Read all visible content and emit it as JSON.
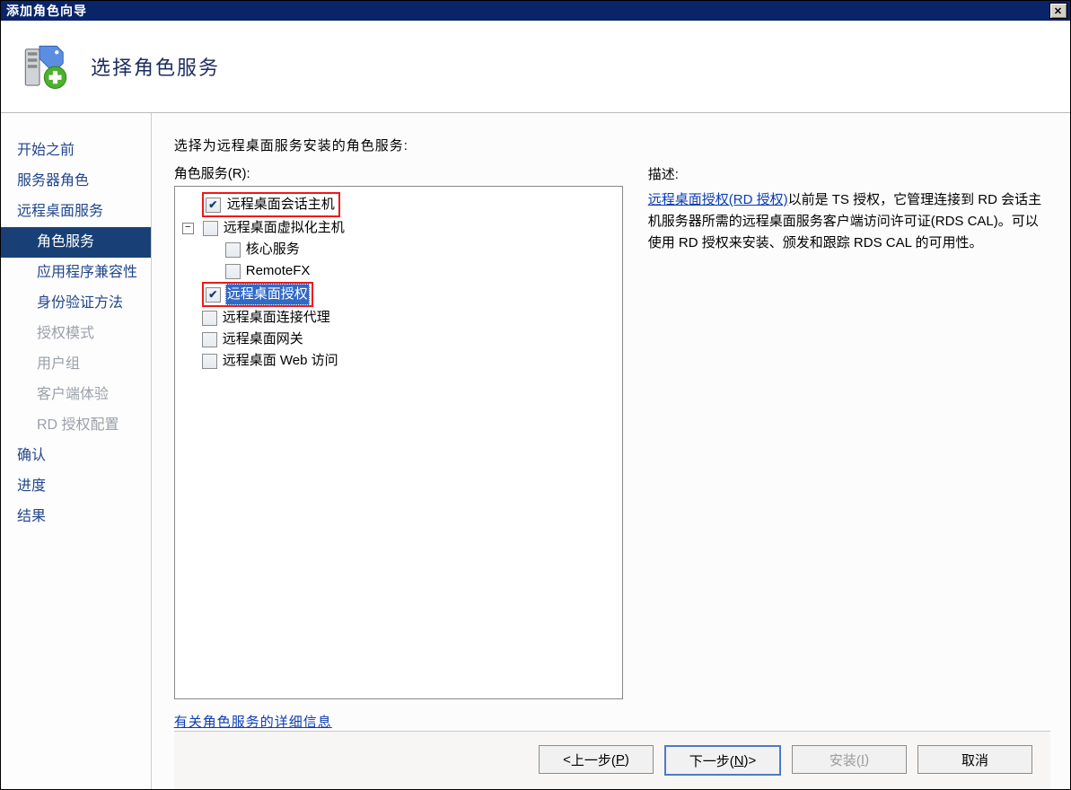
{
  "window": {
    "title": "添加角色向导"
  },
  "header": {
    "page_title": "选择角色服务"
  },
  "sidebar": {
    "items": [
      {
        "label": "开始之前",
        "level": 1,
        "selected": false,
        "disabled": false
      },
      {
        "label": "服务器角色",
        "level": 1,
        "selected": false,
        "disabled": false
      },
      {
        "label": "远程桌面服务",
        "level": 1,
        "selected": false,
        "disabled": false
      },
      {
        "label": "角色服务",
        "level": 2,
        "selected": true,
        "disabled": false
      },
      {
        "label": "应用程序兼容性",
        "level": 2,
        "selected": false,
        "disabled": false
      },
      {
        "label": "身份验证方法",
        "level": 2,
        "selected": false,
        "disabled": false
      },
      {
        "label": "授权模式",
        "level": 2,
        "selected": false,
        "disabled": true
      },
      {
        "label": "用户组",
        "level": 2,
        "selected": false,
        "disabled": true
      },
      {
        "label": "客户端体验",
        "level": 2,
        "selected": false,
        "disabled": true
      },
      {
        "label": "RD 授权配置",
        "level": 2,
        "selected": false,
        "disabled": true
      },
      {
        "label": "确认",
        "level": 1,
        "selected": false,
        "disabled": false
      },
      {
        "label": "进度",
        "level": 1,
        "selected": false,
        "disabled": false
      },
      {
        "label": "结果",
        "level": 1,
        "selected": false,
        "disabled": false
      }
    ]
  },
  "content": {
    "instruction": "选择为远程桌面服务安装的角色服务:",
    "list_label": "角色服务(R):",
    "tree": [
      {
        "label": "远程桌面会话主机",
        "checked": true,
        "depth": 0,
        "highlight_red": true,
        "expander": null,
        "selected": false
      },
      {
        "label": "远程桌面虚拟化主机",
        "checked": false,
        "depth": 0,
        "highlight_red": false,
        "expander": "-",
        "selected": false
      },
      {
        "label": "核心服务",
        "checked": false,
        "depth": 1,
        "highlight_red": false,
        "expander": null,
        "selected": false
      },
      {
        "label": "RemoteFX",
        "checked": false,
        "depth": 1,
        "highlight_red": false,
        "expander": null,
        "selected": false
      },
      {
        "label": "远程桌面授权",
        "checked": true,
        "depth": 0,
        "highlight_red": true,
        "expander": null,
        "selected": true
      },
      {
        "label": "远程桌面连接代理",
        "checked": false,
        "depth": 0,
        "highlight_red": false,
        "expander": null,
        "selected": false
      },
      {
        "label": "远程桌面网关",
        "checked": false,
        "depth": 0,
        "highlight_red": false,
        "expander": null,
        "selected": false
      },
      {
        "label": "远程桌面 Web 访问",
        "checked": false,
        "depth": 0,
        "highlight_red": false,
        "expander": null,
        "selected": false
      }
    ],
    "more_link": "有关角色服务的详细信息"
  },
  "description": {
    "title": "描述:",
    "link_text": "远程桌面授权(RD 授权)",
    "body": "以前是 TS 授权，它管理连接到 RD 会话主机服务器所需的远程桌面服务客户端访问许可证(RDS CAL)。可以使用 RD 授权来安装、颁发和跟踪 RDS CAL 的可用性。"
  },
  "buttons": {
    "prev_symbol": "< ",
    "prev_label": "上一步(",
    "prev_key": "P",
    "prev_end": ")",
    "next_label": "下一步(",
    "next_key": "N",
    "next_end": ") ",
    "next_symbol": ">",
    "install_label": "安装(",
    "install_key": "I",
    "install_end": ")",
    "cancel": "取消"
  }
}
